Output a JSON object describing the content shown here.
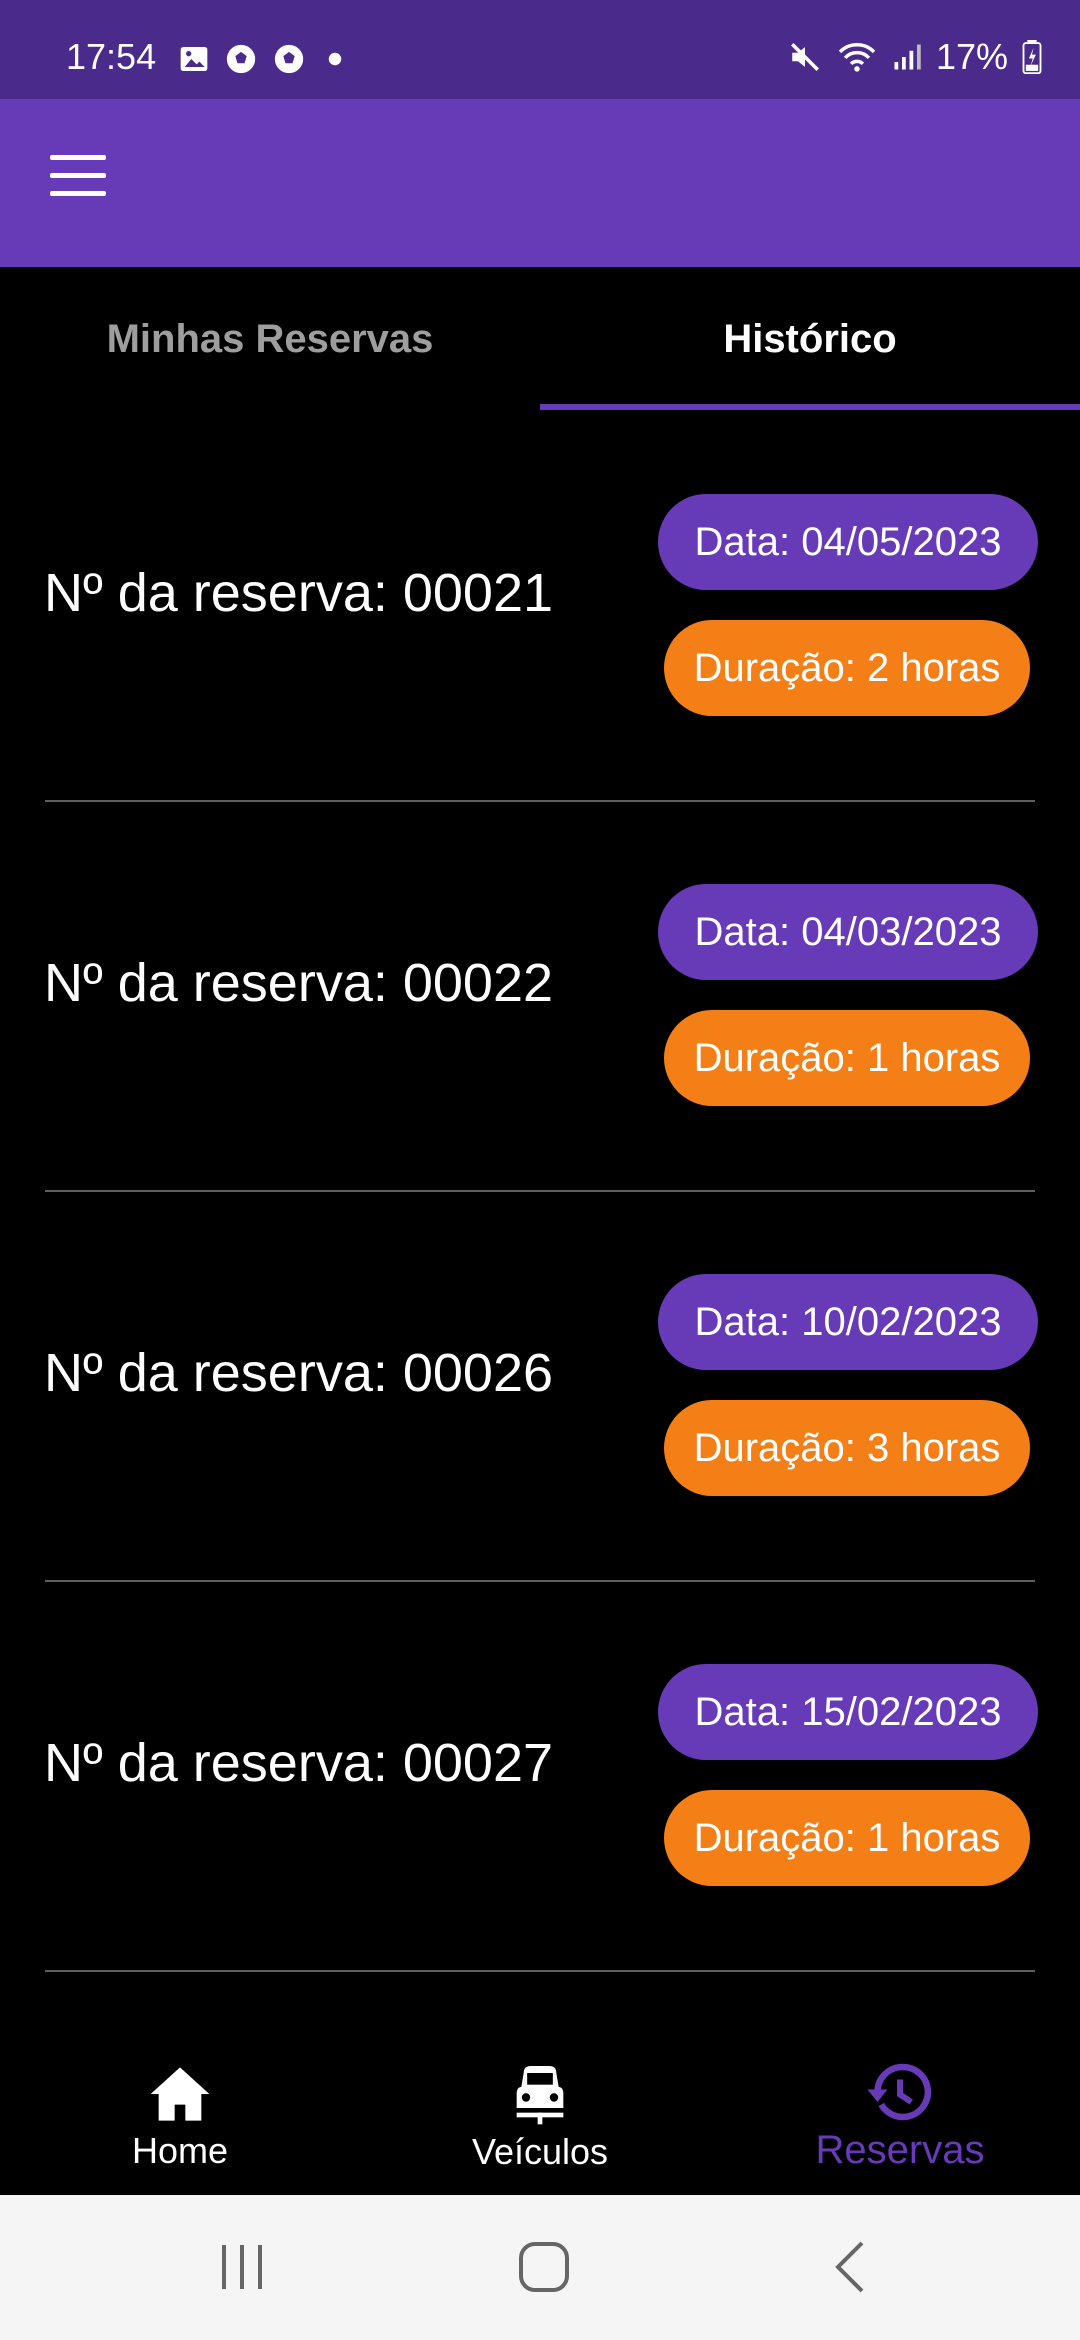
{
  "status_bar": {
    "time": "17:54",
    "battery": "17%",
    "left_icons": [
      "image-icon",
      "soccer-ball-icon",
      "soccer-ball-icon",
      "dot-icon"
    ],
    "right_icons": [
      "mute-icon",
      "wifi-icon",
      "signal-icon",
      "battery-icon"
    ]
  },
  "app_bar": {
    "menu_icon": "menu-icon",
    "color": "#673ab7"
  },
  "tabs": [
    {
      "label": "Minhas Reservas",
      "active": false
    },
    {
      "label": "Histórico",
      "active": true
    }
  ],
  "reservations": [
    {
      "title": "Nº da reserva: 00021",
      "date": "Data: 04/05/2023",
      "duration": "Duração: 2 horas"
    },
    {
      "title": "Nº da reserva: 00022",
      "date": "Data: 04/03/2023",
      "duration": "Duração: 1 horas"
    },
    {
      "title": "Nº da reserva: 00026",
      "date": "Data: 10/02/2023",
      "duration": "Duração: 3 horas"
    },
    {
      "title": "Nº da reserva: 00027",
      "date": "Data: 15/02/2023",
      "duration": "Duração: 1 horas"
    }
  ],
  "bottom_nav": [
    {
      "label": "Home",
      "icon": "home-icon",
      "active": false
    },
    {
      "label": "Veículos",
      "icon": "car-icon",
      "active": false
    },
    {
      "label": "Reservas",
      "icon": "history-icon",
      "active": true
    }
  ],
  "system_nav": [
    "recents-icon",
    "home-circle-icon",
    "back-icon"
  ],
  "colors": {
    "primary": "#673ab7",
    "accent": "#f57f17",
    "background": "#000000"
  }
}
